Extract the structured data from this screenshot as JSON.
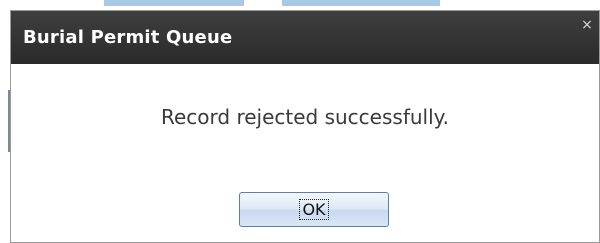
{
  "dialog": {
    "title": "Burial Permit Queue",
    "close_glyph": "×",
    "message": "Record rejected successfully.",
    "ok_label": "OK"
  },
  "colors": {
    "titlebar": "#333333",
    "title_text": "#ffffff",
    "message_text": "#3a3a3a",
    "button_border": "#5e7fa8"
  },
  "icons": {
    "close": "close-icon"
  }
}
